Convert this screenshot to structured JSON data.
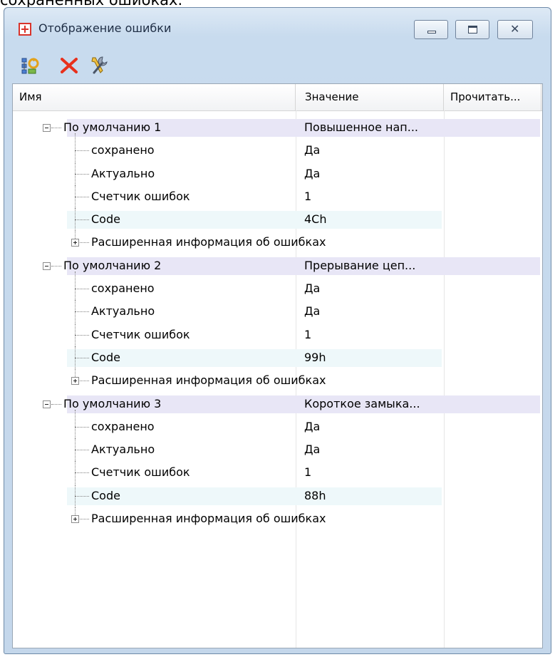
{
  "top_text": "сохраненных ошибках.",
  "window": {
    "title": "Отображение ошибки"
  },
  "toolbar": {
    "icons": [
      "tree-refresh-icon",
      "delete-icon",
      "tools-icon"
    ],
    "delete_color": "#e8301c"
  },
  "columns": {
    "name": "Имя",
    "value": "Значение",
    "read": "Прочитать..."
  },
  "groups": [
    {
      "name": "По умолчанию 1",
      "value": "Повышенное нап...",
      "fields": [
        {
          "name": "сохранено",
          "value": "Да"
        },
        {
          "name": "Актуально",
          "value": "Да"
        },
        {
          "name": "Счетчик ошибок",
          "value": "1"
        },
        {
          "name": "Code",
          "value": "4Ch"
        }
      ],
      "extended": "Расширенная информация об ошибках"
    },
    {
      "name": "По умолчанию 2",
      "value": "Прерывание цеп...",
      "fields": [
        {
          "name": "сохранено",
          "value": "Да"
        },
        {
          "name": "Актуально",
          "value": "Да"
        },
        {
          "name": "Счетчик ошибок",
          "value": "1"
        },
        {
          "name": "Code",
          "value": "99h"
        }
      ],
      "extended": "Расширенная информация об ошибках"
    },
    {
      "name": "По умолчанию 3",
      "value": "Короткое замыка...",
      "fields": [
        {
          "name": "сохранено",
          "value": "Да"
        },
        {
          "name": "Актуально",
          "value": "Да"
        },
        {
          "name": "Счетчик ошибок",
          "value": "1"
        },
        {
          "name": "Code",
          "value": "88h"
        }
      ],
      "extended": "Расширенная информация об ошибках"
    }
  ]
}
